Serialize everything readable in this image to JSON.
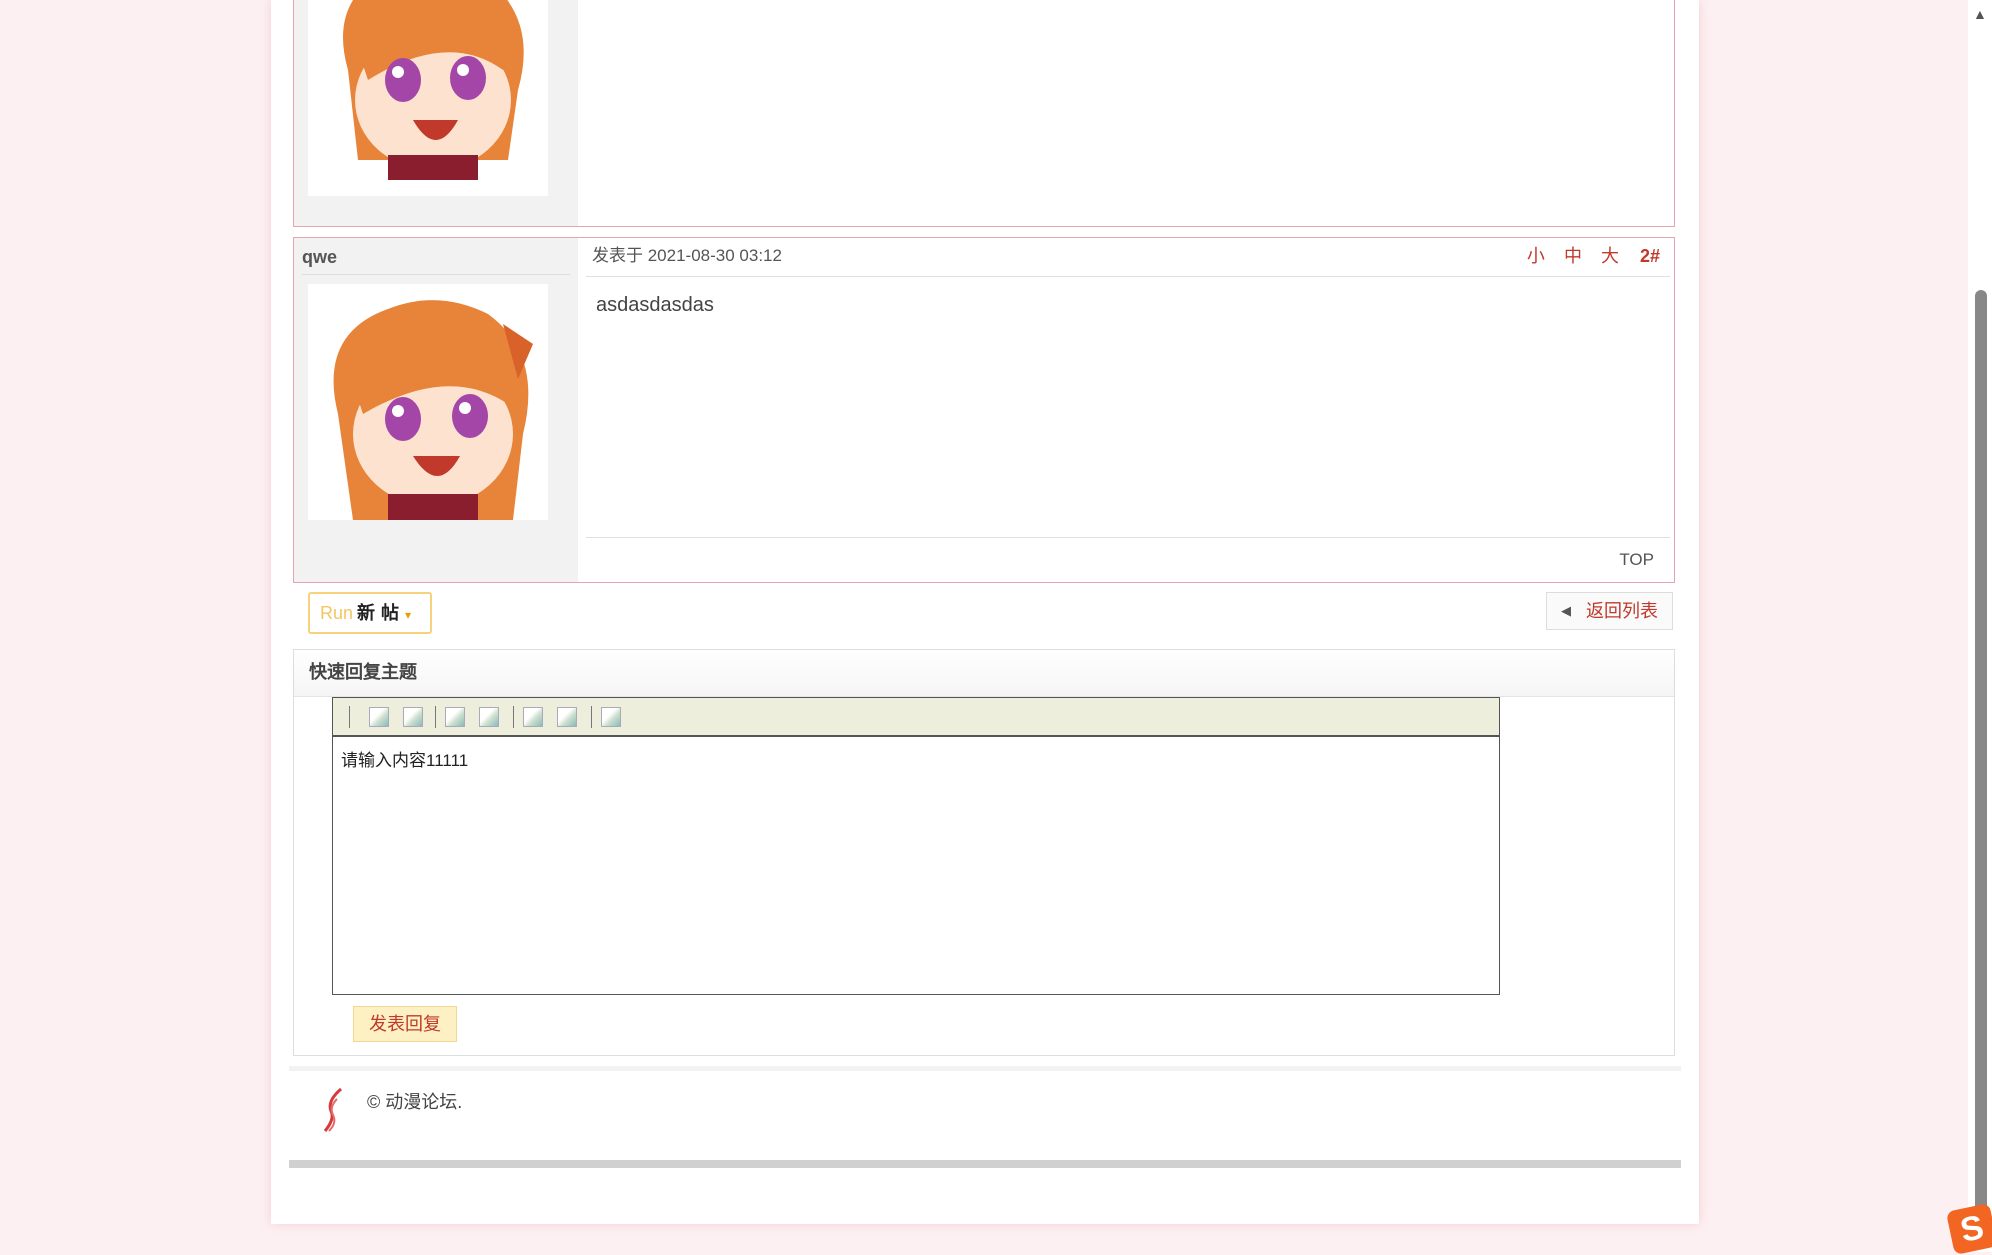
{
  "post2": {
    "username": "qwe",
    "posted_label": "发表于 2021-08-30 03:12",
    "font_small": "小",
    "font_medium": "中",
    "font_large": "大",
    "floor": "2#",
    "content": "asdasdasdas",
    "top_link": "TOP"
  },
  "actions": {
    "newpost_run": "Run",
    "newpost_label": "新帖",
    "newpost_caret": "▾",
    "back_arrow": "◀",
    "back_label": "返回列表"
  },
  "quick_reply": {
    "title": "快速回复主题",
    "editor_content": "请输入内容11111",
    "submit_label": "发表回复"
  },
  "footer": {
    "copyright": "© 动漫论坛."
  },
  "scrollbar": {
    "up_arrow": "▲"
  },
  "ime": {
    "glyph": "S"
  },
  "colors": {
    "accent": "#c0392b",
    "border_pink": "#e6a5b0",
    "page_bg": "#fdf0f2"
  }
}
